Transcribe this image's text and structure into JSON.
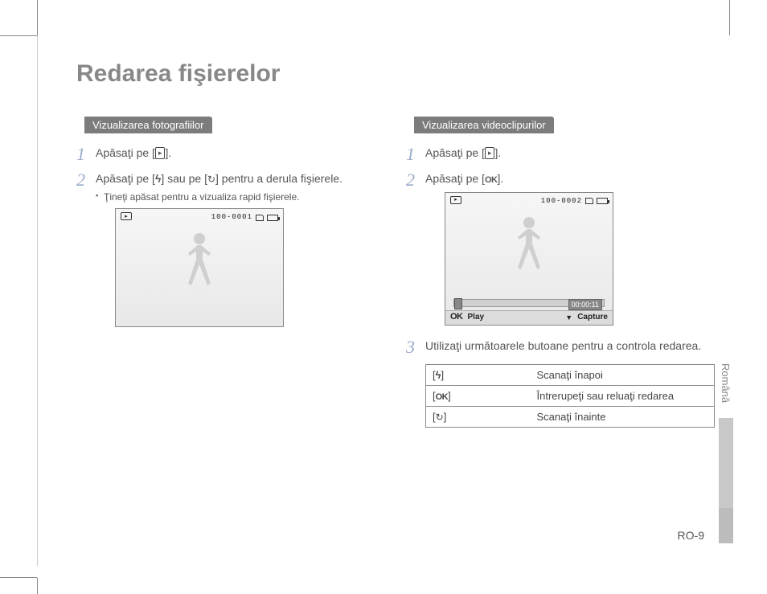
{
  "title": "Redarea fişierelor",
  "left": {
    "heading": "Vizualizarea fotografiilor",
    "step1": "Apăsaţi pe [",
    "step1_end": "].",
    "step2_a": "Apăsaţi pe [",
    "step2_b": "] sau pe [",
    "step2_c": "] pentru a derula fişierele.",
    "sub": "Ţineţi apăsat pentru a vizualiza rapid fişierele.",
    "screen_counter": "100-0001"
  },
  "right": {
    "heading": "Vizualizarea videoclipurilor",
    "step1": "Apăsaţi pe [",
    "step1_end": "].",
    "step2": "Apăsaţi pe [",
    "step2_end": "].",
    "screen_counter": "100-0002",
    "time": "00:00:11",
    "play_label": "Play",
    "capture_label": "Capture",
    "step3": "Utilizaţi următoarele butoane pentru a controla redarea."
  },
  "table": {
    "r1": "Scanaţi înapoi",
    "r2": "Întrerupeţi sau reluaţi redarea",
    "r3": "Scanaţi înainte"
  },
  "side_label": "Română",
  "page_number": "RO-9"
}
